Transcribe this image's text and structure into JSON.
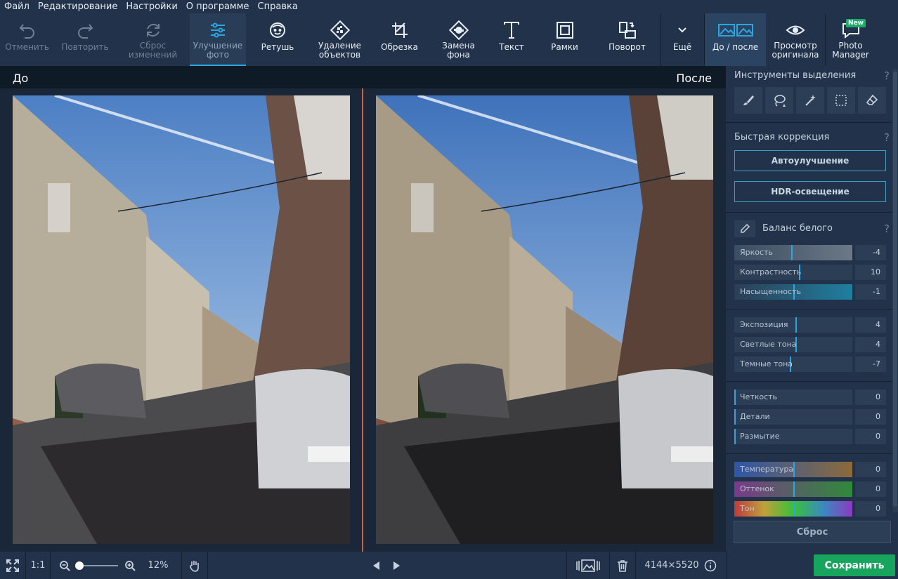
{
  "menu": [
    "Файл",
    "Редактирование",
    "Настройки",
    "О программе",
    "Справка"
  ],
  "toolbar": {
    "undo": "Отменить",
    "redo": "Повторить",
    "reset_line1": "Сброс",
    "reset_line2": "изменений",
    "enhance_line1": "Улучшение",
    "enhance_line2": "фото",
    "retouch": "Ретушь",
    "remove_line1": "Удаление",
    "remove_line2": "объектов",
    "crop": "Обрезка",
    "bg_line1": "Замена",
    "bg_line2": "фона",
    "text": "Текст",
    "frames": "Рамки",
    "rotate": "Поворот",
    "more": "Ещё",
    "before_after": "До / после",
    "view_line1": "Просмотр",
    "view_line2": "оригинала",
    "pm_line1": "Photo",
    "pm_line2": "Manager",
    "new_badge": "New"
  },
  "compare": {
    "before": "До",
    "after": "После"
  },
  "panel": {
    "selection_title": "Инструменты выделения",
    "quick_title": "Быстрая коррекция",
    "auto_btn": "Автоулучшение",
    "hdr_btn": "HDR-освещение",
    "wb_title": "Баланс белого",
    "help": "?",
    "reset": "Сброс",
    "sliders": [
      {
        "name": "Яркость",
        "value": "-4",
        "pos": 0.48
      },
      {
        "name": "Контрастность",
        "value": "10",
        "pos": 0.55
      },
      {
        "name": "Насыщенность",
        "value": "-1",
        "pos": 0.5
      },
      {
        "name": "Экспозиция",
        "value": "4",
        "pos": 0.52
      },
      {
        "name": "Светлые тона",
        "value": "4",
        "pos": 0.52
      },
      {
        "name": "Темные тона",
        "value": "-7",
        "pos": 0.47
      },
      {
        "name": "Четкость",
        "value": "0",
        "pos": 0.0
      },
      {
        "name": "Детали",
        "value": "0",
        "pos": 0.0
      },
      {
        "name": "Размытие",
        "value": "0",
        "pos": 0.0
      },
      {
        "name": "Температура",
        "value": "0",
        "pos": 0.5
      },
      {
        "name": "Оттенок",
        "value": "0",
        "pos": 0.5
      },
      {
        "name": "Тон",
        "value": "0",
        "pos": 0.5
      }
    ]
  },
  "bottom": {
    "one_to_one": "1:1",
    "zoom": "12%",
    "dimensions": "4144×5520",
    "save": "Сохранить"
  },
  "colors": {
    "accent": "#2aa7e0",
    "divider": "#e05a36",
    "save": "#17a55d"
  }
}
